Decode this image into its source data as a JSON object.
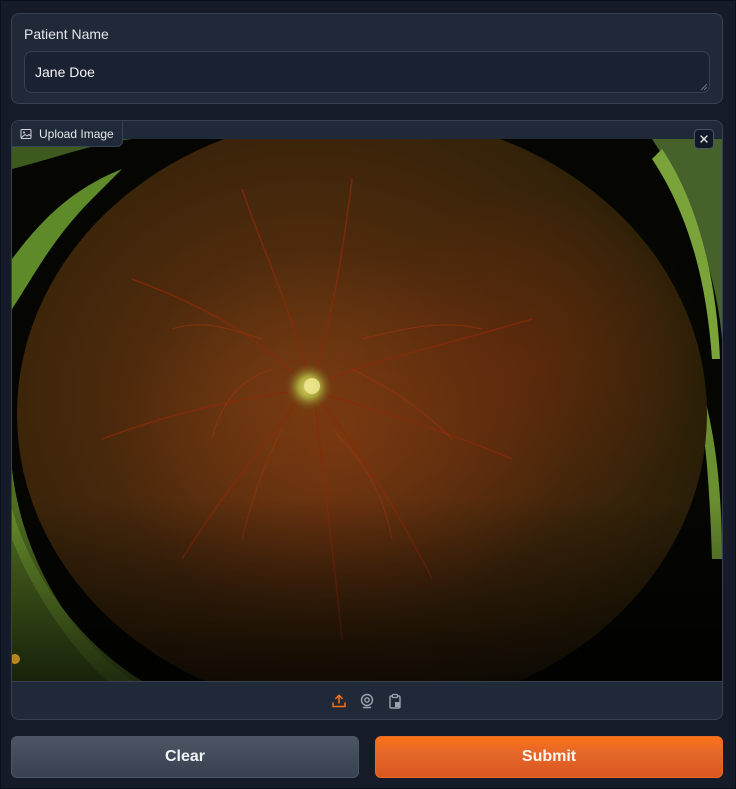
{
  "patient_field": {
    "label": "Patient Name",
    "value": "Jane Doe"
  },
  "image_input": {
    "label": "Upload Image",
    "label_icon": "image-icon",
    "close_icon": "close-icon",
    "sources": [
      {
        "name": "upload-icon",
        "selected": true
      },
      {
        "name": "webcam-icon",
        "selected": false
      },
      {
        "name": "clipboard-icon",
        "selected": false
      }
    ]
  },
  "actions": {
    "clear_label": "Clear",
    "submit_label": "Submit"
  },
  "colors": {
    "background": "#161b29",
    "panel": "#1f2937",
    "border": "#374151",
    "accent": "#f97316",
    "secondary_button": "#4b5563"
  }
}
